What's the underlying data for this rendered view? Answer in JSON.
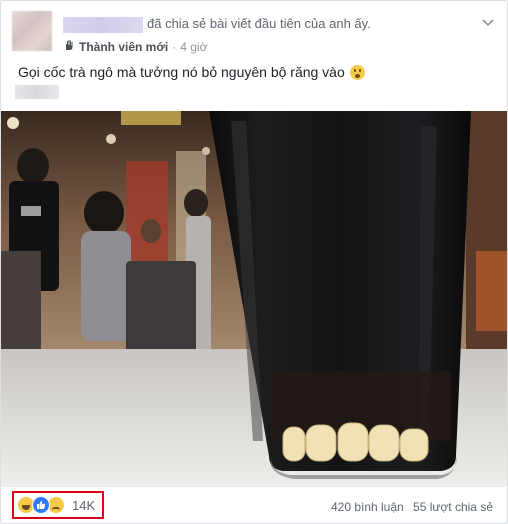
{
  "post": {
    "header_text": "đã chia sẻ bài viết đầu tiên của anh ấy.",
    "badge": "Thành viên mới",
    "separator": "·",
    "time": "4 giờ",
    "caption": "Gọi cốc trà ngô mà tưởng nó bỏ nguyên bộ răng vào"
  },
  "footer": {
    "reaction_count": "14K",
    "comments": "420 bình luận",
    "shares": "55 lượt chia sẻ"
  },
  "icons": {
    "menu": "chevron-down-icon",
    "badge": "new-member-hand-icon",
    "caption_emoji": "flushed-face-icon",
    "reactions": [
      "haha-icon",
      "like-icon",
      "sad-icon"
    ]
  }
}
